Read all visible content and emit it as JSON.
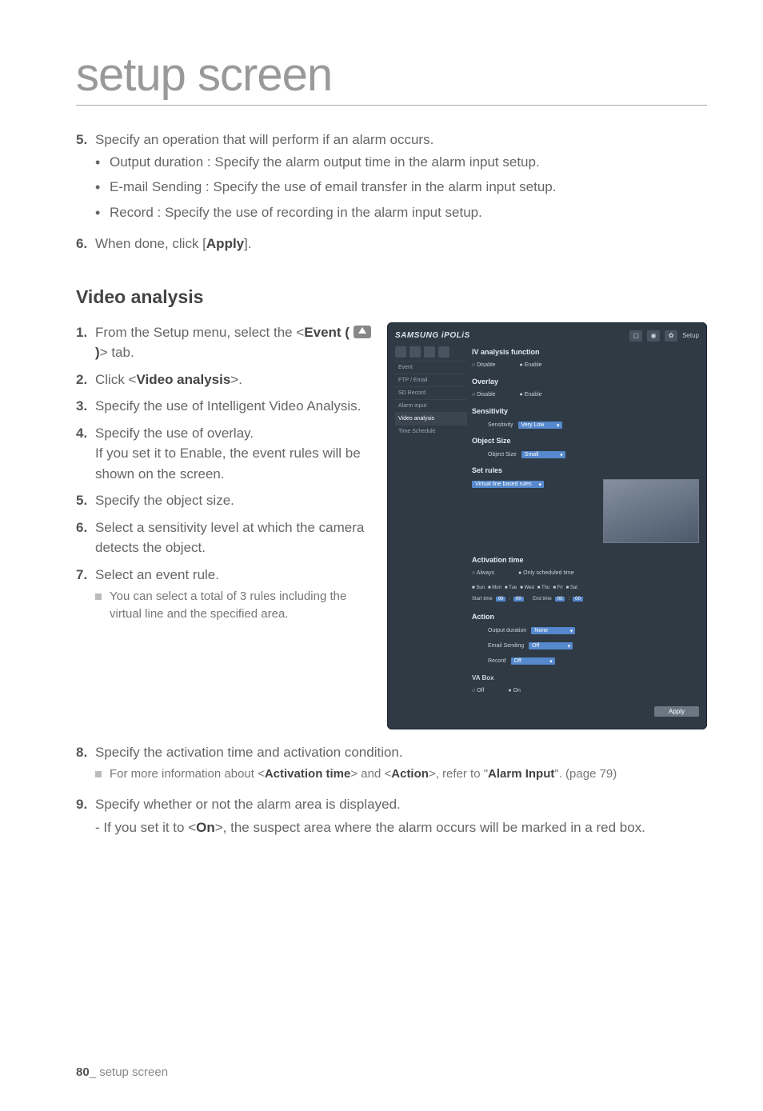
{
  "page_title": "setup screen",
  "intro_steps": [
    {
      "num": "5.",
      "text": "Specify an operation that will perform if an alarm occurs.",
      "bullets": [
        "Output duration : Specify the alarm output time in the alarm input setup.",
        "E-mail Sending : Specify the use of email transfer in the alarm input setup.",
        "Record : Specify the use of recording in the alarm input setup."
      ]
    },
    {
      "num": "6.",
      "html": "When done, click [<b>Apply</b>]."
    }
  ],
  "section_heading": "Video analysis",
  "left_steps": [
    {
      "num": "1.",
      "html": "From the Setup menu, select the <<b>Event (</b> <span class='event-icon' data-name='event-tab-icon' data-interactable='false'></span> <b>)</b>> tab."
    },
    {
      "num": "2.",
      "html": "Click <<b>Video analysis</b>>."
    },
    {
      "num": "3.",
      "text": "Specify the use of Intelligent Video Analysis."
    },
    {
      "num": "4.",
      "text": "Specify the use of overlay.\nIf you set it to Enable, the event rules will be shown on the screen."
    },
    {
      "num": "5.",
      "text": "Specify the object size."
    },
    {
      "num": "6.",
      "text": "Select a sensitivity level at which the camera detects the object."
    },
    {
      "num": "7.",
      "text": "Select an event rule.",
      "note": "You can select a total of 3 rules including the virtual line and the specified area."
    }
  ],
  "full_steps_after": [
    {
      "num": "8.",
      "text": "Specify the activation time and activation condition.",
      "note_html": "For more information about <<b>Activation time</b>> and <<b>Action</b>>, refer to \"<b>Alarm Input</b>\". (page 79)"
    },
    {
      "num": "9.",
      "text": "Specify whether or not the alarm area is displayed.",
      "sub_html": "- If you set it to <<b>On</b>>, the suspect area where the alarm occurs will be marked in a red box."
    }
  ],
  "footer": {
    "page_num": "80",
    "label": "_ setup screen"
  },
  "screenshot": {
    "brand": "SAMSUNG iPOLiS",
    "top_label": "Setup",
    "side_items": [
      "Event",
      "FTP / Email",
      "SD Record",
      "Alarm input",
      "Video analysis",
      "Time Schedule"
    ],
    "active_side": "Video analysis",
    "sections": {
      "iv_func": {
        "title": "IV analysis function",
        "opt_off": "Disable",
        "opt_on": "Enable"
      },
      "overlay": {
        "title": "Overlay",
        "opt_off": "Disable",
        "opt_on": "Enable"
      },
      "sensitivity": {
        "title": "Sensitivity",
        "label": "Sensitivity",
        "value": "Very Low"
      },
      "object_size": {
        "title": "Object Size",
        "label": "Object Size",
        "value": "Small"
      },
      "set_rules": {
        "title": "Set rules",
        "label": "Virtual line based rules"
      },
      "activation": {
        "title": "Activation time",
        "opt_always": "Always",
        "opt_sched": "Only scheduled time",
        "days": [
          "Sun",
          "Mon",
          "Tue",
          "Wed",
          "Thu",
          "Fri",
          "Sat"
        ],
        "start_label": "Start time",
        "end_label": "End time",
        "h": "00",
        "m": "00"
      },
      "action": {
        "title": "Action",
        "rows": [
          {
            "label": "Output duration",
            "value": "None"
          },
          {
            "label": "Email Sending",
            "value": "Off"
          },
          {
            "label": "Record",
            "value": "Off"
          }
        ],
        "va_box": "VA Box",
        "va_off": "Off",
        "va_on": "On"
      },
      "apply": "Apply"
    }
  }
}
